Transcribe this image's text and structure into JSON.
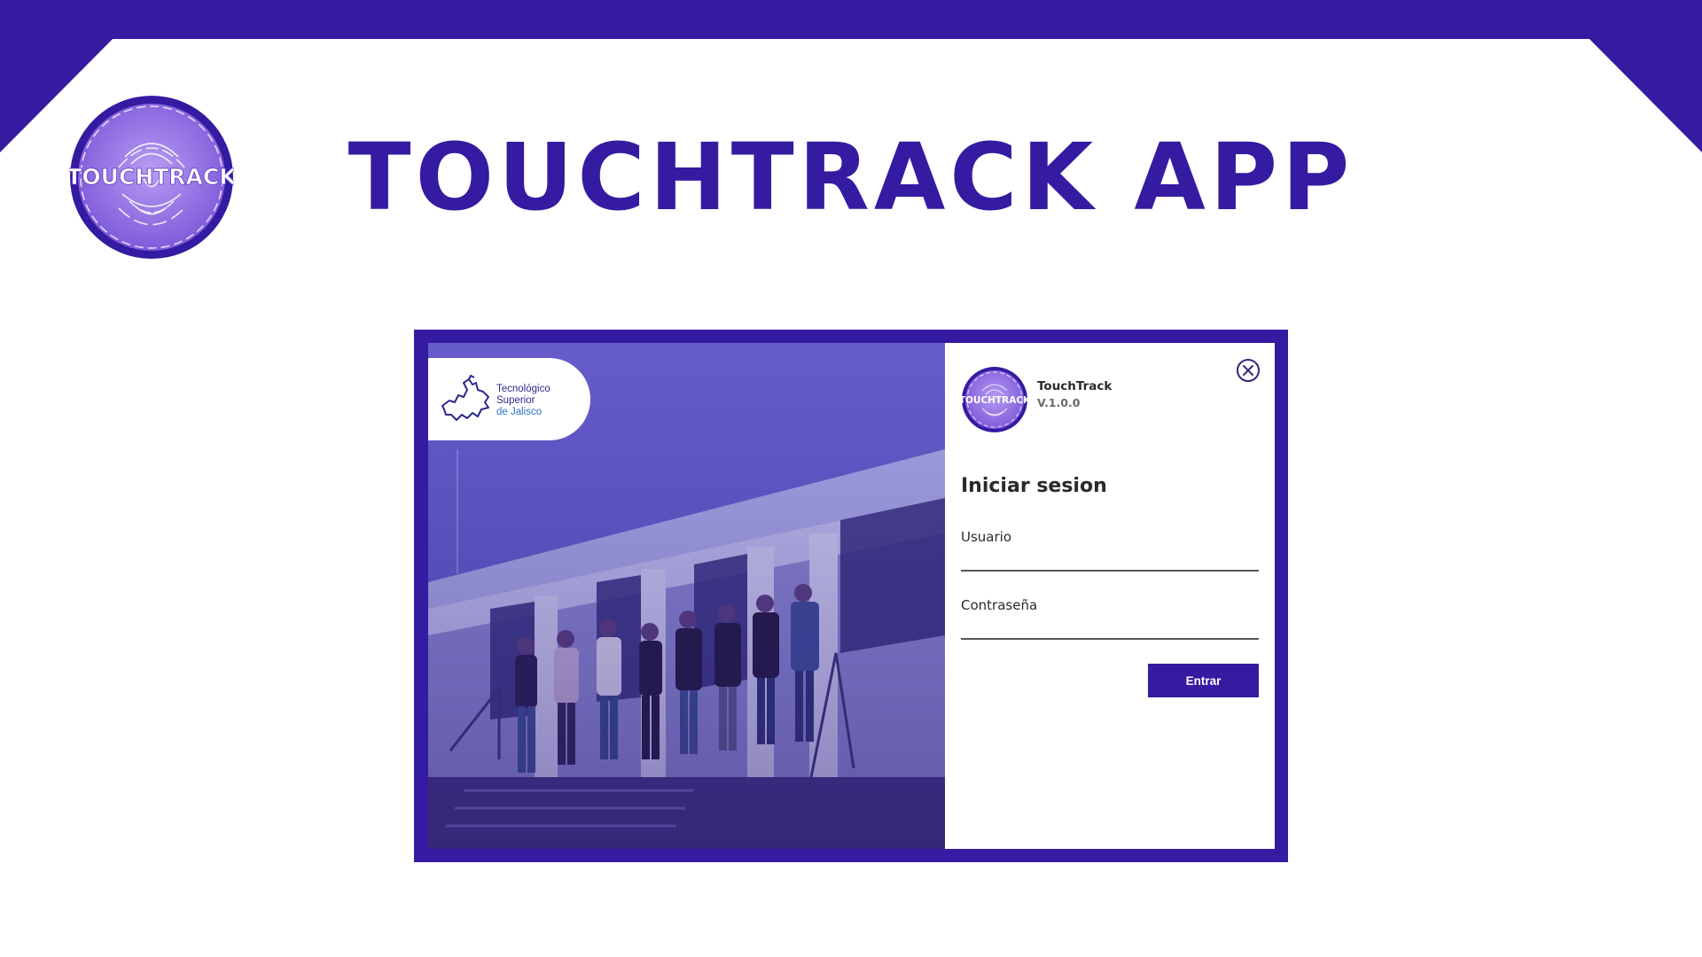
{
  "page": {
    "title": "TOUCHTRACK APP",
    "brand_logo_text": "TOUCHTRACK",
    "accent_color": "#341ba1"
  },
  "app_window": {
    "school": {
      "name_line1": "Tecnológico",
      "name_line2": "Superior",
      "name_line3": "de Jalisco",
      "icon": "jalisco-map-icon"
    },
    "login": {
      "logo_text": "TOUCHTRACK",
      "app_name": "TouchTrack",
      "version": "V.1.0.0",
      "heading": "Iniciar sesion",
      "username_label": "Usuario",
      "username_value": "",
      "password_label": "Contraseña",
      "password_value": "",
      "submit_label": "Entrar",
      "close_icon": "close-icon"
    }
  }
}
